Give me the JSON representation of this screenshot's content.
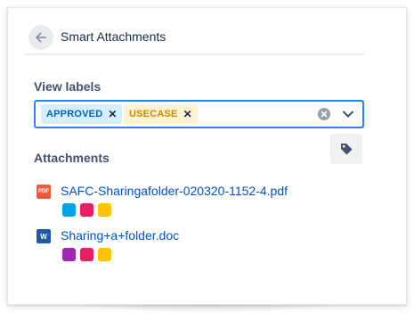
{
  "header": {
    "title": "Smart Attachments",
    "back_icon": "arrow-left-icon"
  },
  "view_labels": {
    "label": "View labels",
    "selected_tags": [
      {
        "text": "APPROVED",
        "color": "#0065b8",
        "bg": "#d5efff"
      },
      {
        "text": "USECASE",
        "color": "#c88a00",
        "bg": "#fff3d1"
      }
    ],
    "remove_icon": "x-icon",
    "clear_icon": "clear-circle-icon",
    "dropdown_icon": "chevron-down-icon",
    "focus_border_color": "#2684ff"
  },
  "attachments": {
    "label": "Attachments",
    "tag_button_icon": "tag-icon",
    "items": [
      {
        "name": "SAFC-Sharingafolder-020320-1152-4.pdf",
        "type_icon": "pdf-file-icon",
        "icon_text": "PDF",
        "label_colors": [
          "#00a3e6",
          "#e91e63",
          "#ffc400"
        ]
      },
      {
        "name": "Sharing+a+folder.doc",
        "type_icon": "word-file-icon",
        "icon_text": "W",
        "label_colors": [
          "#9c27b0",
          "#e91e63",
          "#ffc400"
        ]
      }
    ]
  },
  "colors": {
    "link": "#0052cc",
    "heading": "#42526e",
    "text": "#172b4d"
  }
}
